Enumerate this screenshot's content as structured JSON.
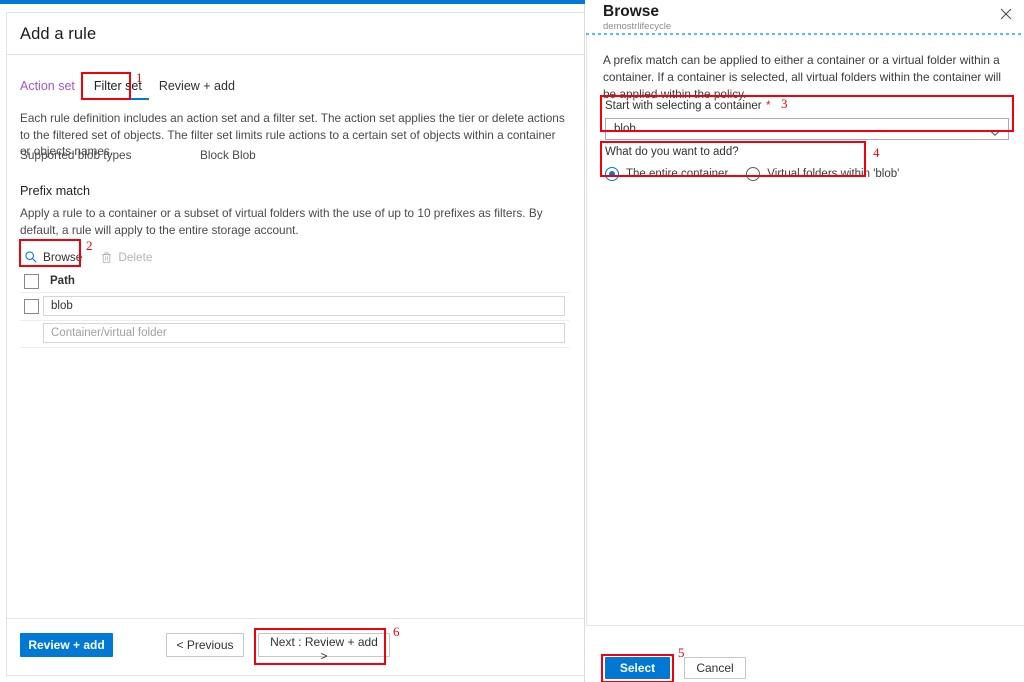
{
  "left_blade": {
    "title": "Add a rule",
    "tabs": [
      {
        "label": "Action set",
        "state": "visited"
      },
      {
        "label": "Filter set",
        "state": "active"
      },
      {
        "label": "Review + add",
        "state": "default"
      }
    ],
    "description": "Each rule definition includes an action set and a filter set. The action set applies the tier or delete actions to the filtered set of objects. The filter set limits rule actions to a certain set of objects within a container or objects names.",
    "supported_blob_types": {
      "label": "Supported blob types",
      "value": "Block Blob"
    },
    "prefix_match": {
      "heading": "Prefix match",
      "description": "Apply a rule to a container or a subset of virtual folders with the use of up to 10 prefixes as filters. By default, a rule will apply to the entire storage account."
    },
    "commands": [
      {
        "label": "Browse",
        "icon": "search-icon",
        "enabled": true
      },
      {
        "label": "Delete",
        "icon": "trash-icon",
        "enabled": false
      }
    ],
    "table": {
      "column_header": "Path",
      "rows": [
        {
          "value": "blob",
          "placeholder": "Container/virtual folder"
        },
        {
          "value": "",
          "placeholder": "Container/virtual folder"
        }
      ]
    },
    "footer": {
      "review_add": "Review + add",
      "previous": "< Previous",
      "next": "Next : Review + add >"
    }
  },
  "right_blade": {
    "title": "Browse",
    "subtitle": "demostrlifecycle",
    "close_icon": "close-icon",
    "description": "A prefix match can be applied to either a container or a virtual folder within a container. If a container is selected, all virtual folders within the container will be applied within the policy.",
    "container_field": {
      "label": "Start with selecting a container",
      "required_marker": "*",
      "selected_value": "blob",
      "chevron_icon": "chevron-down-icon"
    },
    "add_target": {
      "label": "What do you want to add?",
      "options": [
        {
          "label": "The entire container",
          "selected": true
        },
        {
          "label": "Virtual folders within 'blob'",
          "selected": false
        }
      ]
    },
    "footer": {
      "select": "Select",
      "cancel": "Cancel"
    }
  },
  "annotations": {
    "numbers": [
      "1",
      "2",
      "3",
      "4",
      "5",
      "6"
    ]
  },
  "colors": {
    "accent_blue": "#0078d4",
    "annotation_red": "#f2000c",
    "visited_tab_purple": "#a855c8",
    "dotted_rule_blue": "#4ec3f0"
  }
}
